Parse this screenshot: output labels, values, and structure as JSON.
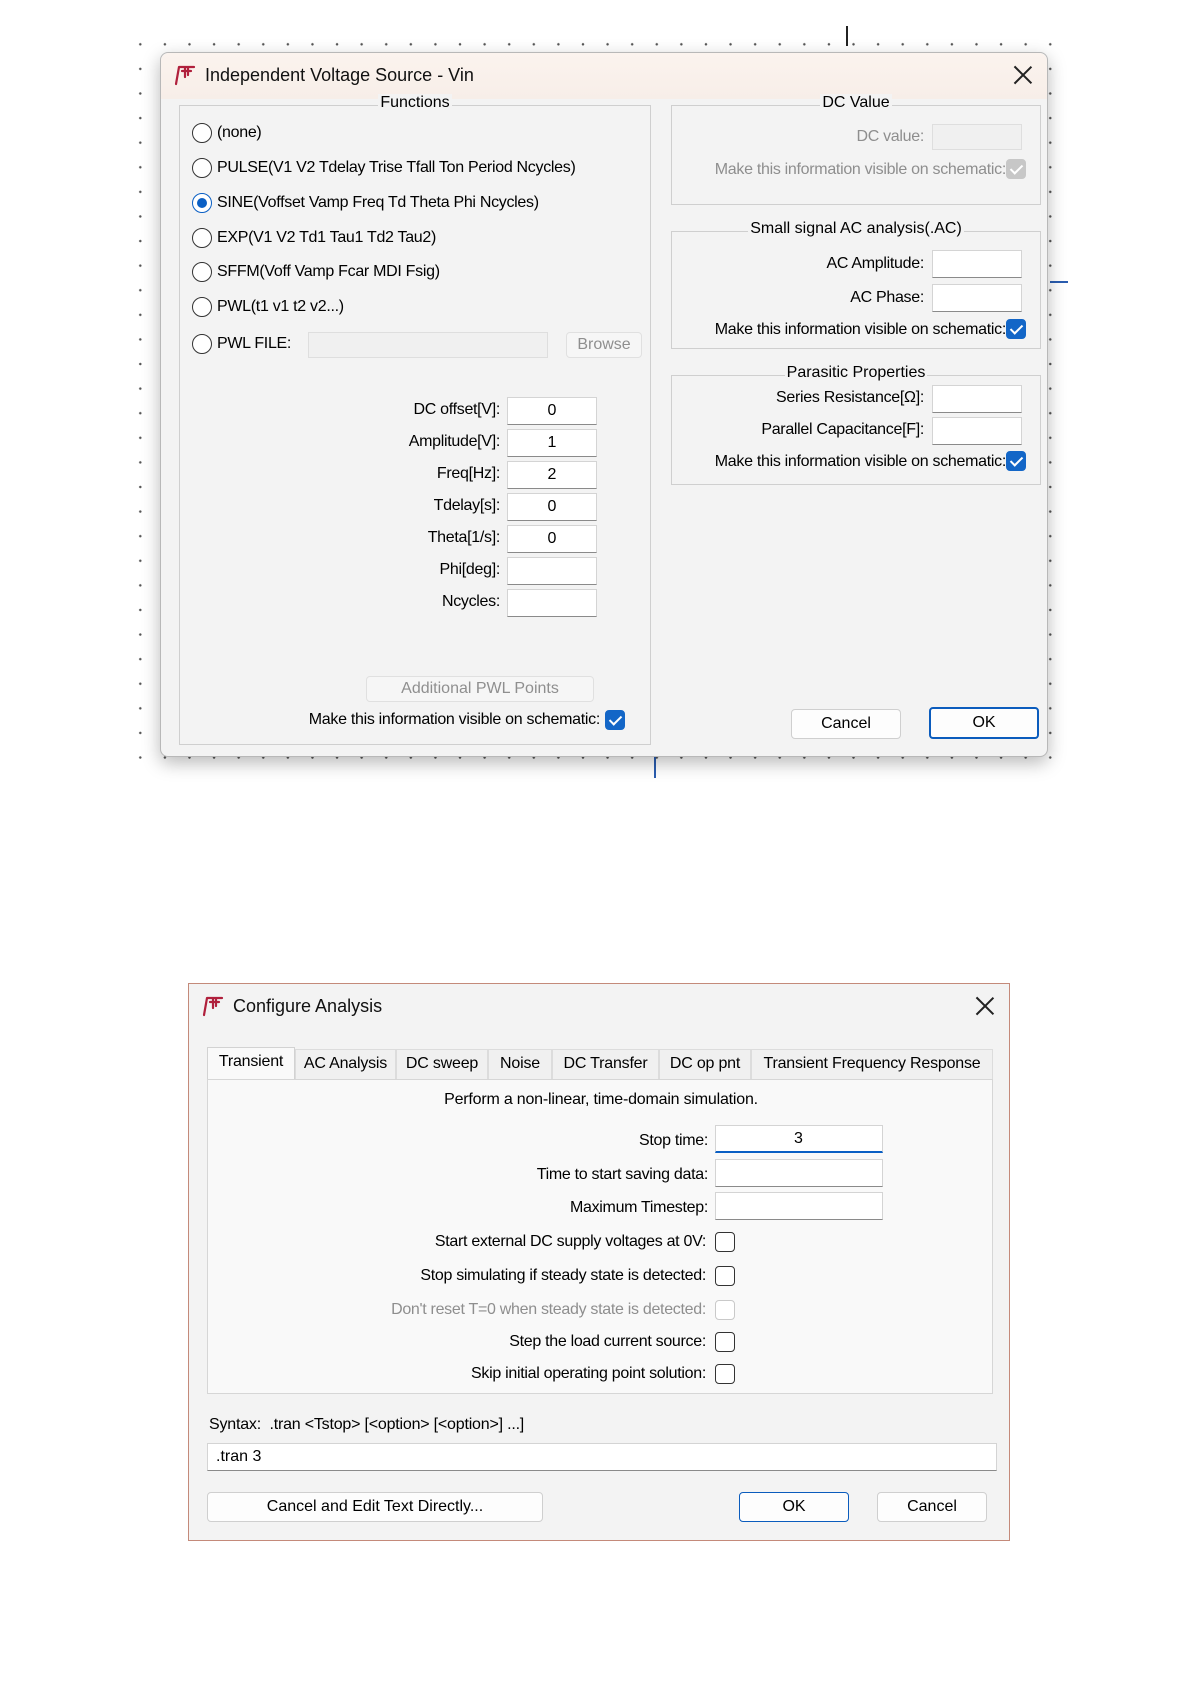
{
  "dialog1": {
    "title": "Independent Voltage Source - Vin",
    "functions": {
      "title": "Functions",
      "options": [
        {
          "label": "(none)",
          "selected": false
        },
        {
          "label": "PULSE(V1 V2 Tdelay Trise Tfall Ton Period Ncycles)",
          "selected": false
        },
        {
          "label": "SINE(Voffset Vamp Freq Td Theta Phi Ncycles)",
          "selected": true
        },
        {
          "label": "EXP(V1 V2 Td1 Tau1 Td2 Tau2)",
          "selected": false
        },
        {
          "label": "SFFM(Voff Vamp Fcar MDI Fsig)",
          "selected": false
        },
        {
          "label": "PWL(t1 v1 t2 v2...)",
          "selected": false
        },
        {
          "label": "PWL FILE:",
          "selected": false
        }
      ],
      "browse_label": "Browse",
      "fields": [
        {
          "label": "DC offset[V]:",
          "value": "0"
        },
        {
          "label": "Amplitude[V]:",
          "value": "1"
        },
        {
          "label": "Freq[Hz]:",
          "value": "2"
        },
        {
          "label": "Tdelay[s]:",
          "value": "0"
        },
        {
          "label": "Theta[1/s]:",
          "value": "0"
        },
        {
          "label": "Phi[deg]:",
          "value": ""
        },
        {
          "label": "Ncycles:",
          "value": ""
        }
      ],
      "pwl_points_label": "Additional PWL Points",
      "visible_label": "Make this information visible on schematic:",
      "visible_checked": true
    },
    "dc_value": {
      "title": "DC Value",
      "dc_label": "DC value:",
      "dc_value": "",
      "visible_label": "Make this information visible on schematic:",
      "visible_checked": true
    },
    "ac": {
      "title": "Small signal AC analysis(.AC)",
      "amplitude_label": "AC Amplitude:",
      "amplitude_value": "",
      "phase_label": "AC Phase:",
      "phase_value": "",
      "visible_label": "Make this information visible on schematic:",
      "visible_checked": true
    },
    "parasitic": {
      "title": "Parasitic Properties",
      "series_label": "Series Resistance[Ω]:",
      "series_value": "",
      "parallel_label": "Parallel Capacitance[F]:",
      "parallel_value": "",
      "visible_label": "Make this information visible on schematic:",
      "visible_checked": true
    },
    "cancel_label": "Cancel",
    "ok_label": "OK"
  },
  "dialog2": {
    "title": "Configure Analysis",
    "tabs": [
      "Transient",
      "AC Analysis",
      "DC sweep",
      "Noise",
      "DC Transfer",
      "DC op pnt",
      "Transient Frequency Response"
    ],
    "active_tab": "Transient",
    "description": "Perform a non-linear, time-domain simulation.",
    "stop_time_label": "Stop time:",
    "stop_time_value": "3",
    "start_saving_label": "Time to start saving data:",
    "start_saving_value": "",
    "max_timestep_label": "Maximum Timestep:",
    "max_timestep_value": "",
    "options": [
      {
        "label": "Start external DC supply voltages at 0V:",
        "checked": false,
        "disabled": false
      },
      {
        "label": "Stop simulating if steady state is detected:",
        "checked": false,
        "disabled": false
      },
      {
        "label": "Don't reset T=0 when steady state is detected:",
        "checked": false,
        "disabled": true
      },
      {
        "label": "Step the load current source:",
        "checked": false,
        "disabled": false
      },
      {
        "label": "Skip initial operating point solution:",
        "checked": false,
        "disabled": false
      }
    ],
    "syntax_label": "Syntax:  .tran <Tstop> [<option> [<option>] ...]",
    "command_text": ".tran 3",
    "edit_text_label": "Cancel and Edit Text Directly...",
    "ok_label": "OK",
    "cancel_label": "Cancel"
  },
  "colors": {
    "accent": "#0a5fc4",
    "dialog_bg": "#f3f3f3",
    "wire": "#2a5db0"
  }
}
